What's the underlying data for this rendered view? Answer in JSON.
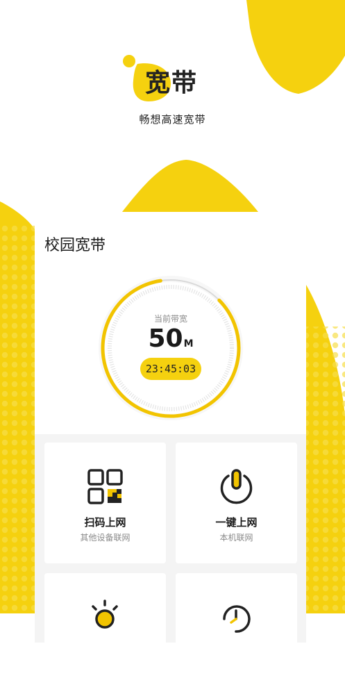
{
  "brand": {
    "logo_text": "宽带",
    "slogan": "畅想高速宽带"
  },
  "card": {
    "title": "校园宽带",
    "bandwidth_label": "当前带宽",
    "bandwidth_value": "50",
    "bandwidth_unit": "M",
    "timer": "23:45:03",
    "progress_fraction": 0.85
  },
  "tiles": [
    {
      "label": "扫码上网",
      "sub": "其他设备联网",
      "icon": "qr-code-icon"
    },
    {
      "label": "一键上网",
      "sub": "本机联网",
      "icon": "power-icon"
    },
    {
      "label": "",
      "sub": "",
      "icon": "lightbulb-icon"
    },
    {
      "label": "",
      "sub": "",
      "icon": "clock-icon"
    }
  ],
  "colors": {
    "accent": "#f5d10f",
    "accent_dark": "#f2c400",
    "dots": "#f7de4a"
  }
}
